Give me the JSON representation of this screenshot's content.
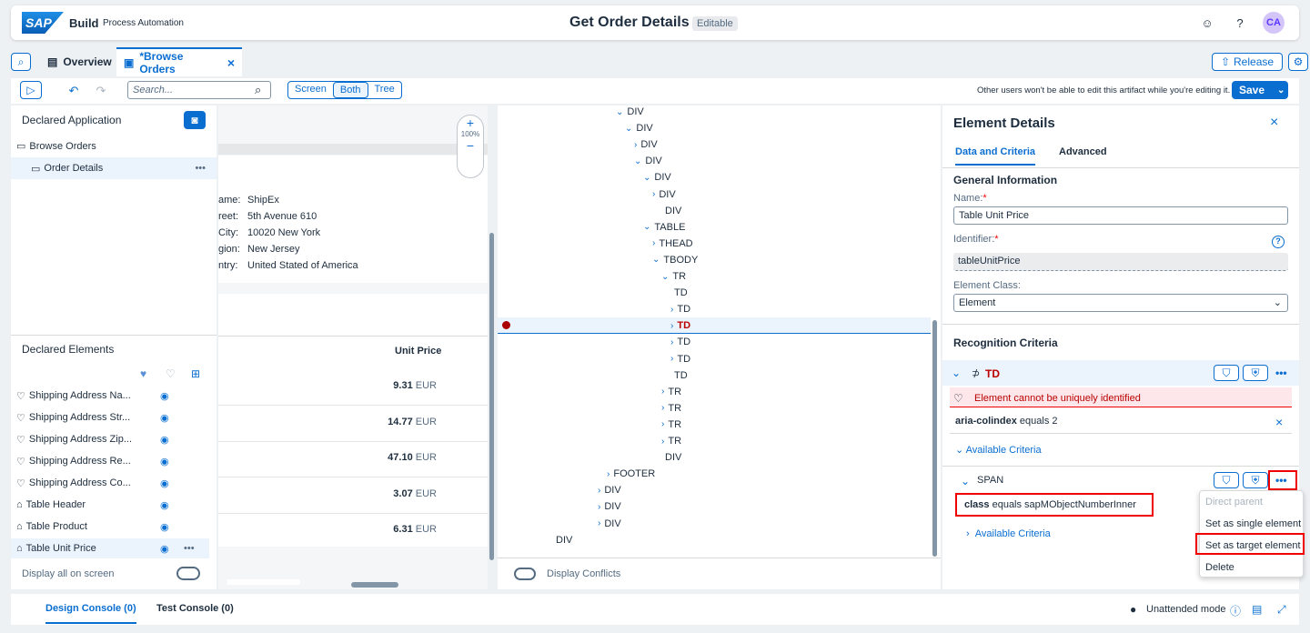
{
  "shell": {
    "brand": "SAP",
    "app": "Build",
    "sub": "Process Automation",
    "title": "Get Order Details",
    "badge": "Editable",
    "avatar": "CA"
  },
  "tabs": [
    {
      "label": "Overview"
    },
    {
      "label": "*Browse Orders"
    }
  ],
  "release": "Release",
  "toolbar": {
    "search_placeholder": "Search...",
    "views": [
      "Screen",
      "Both",
      "Tree"
    ],
    "note": "Other users won't be able to edit this artifact while you're editing it.",
    "save": "Save"
  },
  "declared_app": {
    "title": "Declared Application",
    "items": [
      "Browse Orders",
      "Order Details"
    ]
  },
  "declared_elements": {
    "title": "Declared Elements",
    "items": [
      "Shipping Address Na...",
      "Shipping Address Str...",
      "Shipping Address Zip...",
      "Shipping Address Re...",
      "Shipping Address Co...",
      "Table Header",
      "Table Product",
      "Table Unit Price"
    ],
    "display_all": "Display all on screen"
  },
  "preview": {
    "zoom": "100%",
    "labels": [
      "ame:",
      "reet:",
      "City:",
      "gion:",
      "ntry:"
    ],
    "values": [
      "ShipEx",
      "5th Avenue 610",
      "10020 New York",
      "New Jersey",
      "United Stated of America"
    ],
    "col_header": "Unit Price",
    "prices": [
      "9.31",
      "14.77",
      "47.10",
      "3.07",
      "6.31"
    ],
    "currency": "EUR"
  },
  "dom_tree": {
    "nodes": [
      [
        "DIV",
        1
      ],
      [
        "DIV",
        1
      ],
      [
        "DIV",
        1
      ],
      [
        "DIV",
        1
      ],
      [
        "DIV",
        1
      ],
      [
        "DIV",
        1
      ],
      [
        "DIV",
        0
      ],
      [
        "TABLE",
        1
      ],
      [
        "THEAD",
        1
      ],
      [
        "TBODY",
        1
      ],
      [
        "TR",
        1
      ],
      [
        "TD",
        0
      ],
      [
        "TD",
        1
      ],
      [
        "TD",
        1
      ],
      [
        "TD",
        1
      ],
      [
        "TD",
        1
      ],
      [
        "TD",
        0
      ],
      [
        "TR",
        1
      ],
      [
        "TR",
        1
      ],
      [
        "TR",
        1
      ],
      [
        "TR",
        1
      ],
      [
        "DIV",
        0
      ],
      [
        "FOOTER",
        1
      ],
      [
        "DIV",
        1
      ],
      [
        "DIV",
        1
      ],
      [
        "DIV",
        1
      ],
      [
        "DIV",
        0
      ]
    ],
    "display_conflicts": "Display Conflicts"
  },
  "details": {
    "title": "Element Details",
    "tabs": [
      "Data and Criteria",
      "Advanced"
    ],
    "general": "General Information",
    "name_label": "Name:",
    "name": "Table Unit Price",
    "id_label": "Identifier:",
    "id": "tableUnitPrice",
    "class_label": "Element Class:",
    "class": "Element",
    "recognition": "Recognition Criteria",
    "td": "TD",
    "warning": "Element cannot be uniquely identified",
    "crit1_key": "aria-colindex",
    "crit1_rest": " equals 2",
    "available": "Available Criteria",
    "span": "SPAN",
    "crit2_key": "class",
    "crit2_rest": " equals sapMObjectNumberInner",
    "menu": [
      "Direct parent",
      "Set as single element",
      "Set as target element",
      "Delete"
    ]
  },
  "console": {
    "tabs": [
      "Design Console (0)",
      "Test Console (0)"
    ],
    "mode": "Unattended mode"
  }
}
